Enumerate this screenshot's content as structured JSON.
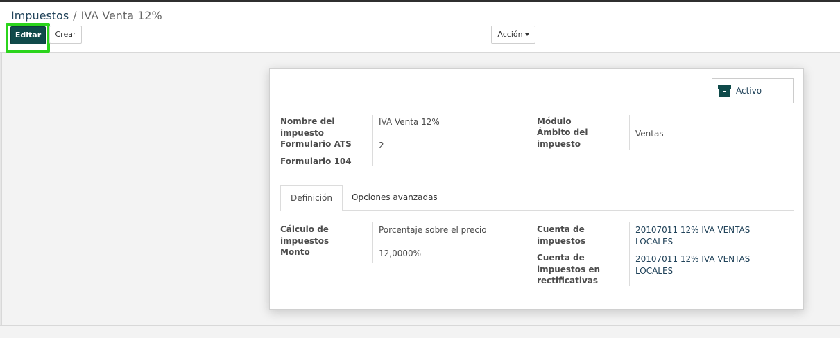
{
  "breadcrumb": {
    "parent": "Impuestos",
    "separator": "/",
    "current": "IVA Venta 12%"
  },
  "toolbar": {
    "edit_label": "Editar",
    "create_label": "Crear",
    "action_label": "Acción"
  },
  "status": {
    "label": "Activo"
  },
  "header_fields": {
    "tax_name_label": "Nombre del impuesto",
    "tax_name_value": "IVA Venta 12%",
    "ats_form_label": "Formulario ATS",
    "ats_form_value": "2",
    "form_104_label": "Formulario 104",
    "module_label": "Módulo",
    "scope_label": "Ámbito del impuesto",
    "scope_value": "Ventas"
  },
  "tabs": [
    {
      "label": "Definición",
      "active": true
    },
    {
      "label": "Opciones avanzadas",
      "active": false
    }
  ],
  "definition": {
    "computation_label": "Cálculo de impuestos",
    "computation_value": "Porcentaje sobre el precio",
    "amount_label": "Monto",
    "amount_value": "12,0000%",
    "tax_account_label": "Cuenta de impuestos",
    "tax_account_value": "20107011 12% IVA VENTAS LOCALES",
    "refund_account_label": "Cuenta de impuestos en rectificativas",
    "refund_account_value": "20107011 12% IVA VENTAS LOCALES"
  },
  "colors": {
    "primary": "#0f4a4a",
    "link": "#21435a",
    "highlight": "#2bd41c"
  }
}
